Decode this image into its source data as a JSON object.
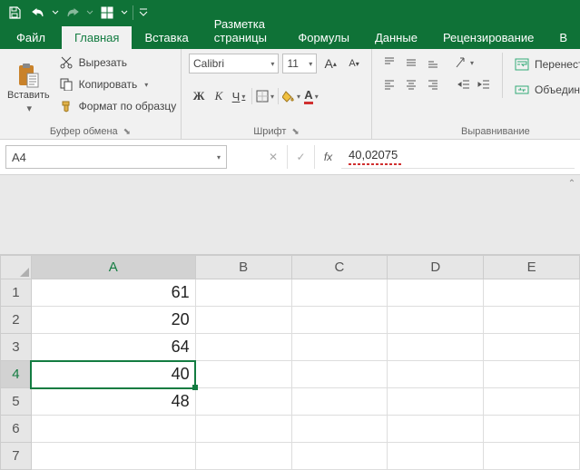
{
  "qat": {
    "save": "save",
    "undo": "undo",
    "redo": "redo",
    "custom": "customize"
  },
  "tabs": {
    "file": "Файл",
    "items": [
      "Главная",
      "Вставка",
      "Разметка страницы",
      "Формулы",
      "Данные",
      "Рецензирование",
      "В"
    ],
    "active_index": 0
  },
  "ribbon": {
    "clipboard": {
      "paste": "Вставить",
      "cut": "Вырезать",
      "copy": "Копировать",
      "painter": "Формат по образцу",
      "label": "Буфер обмена"
    },
    "font": {
      "name": "Calibri",
      "size": "11",
      "bold": "Ж",
      "italic": "К",
      "underline": "Ч",
      "label": "Шрифт"
    },
    "align": {
      "wrap": "Перенести тек",
      "merge": "Объединить и",
      "label": "Выравнивание"
    }
  },
  "formula_bar": {
    "name_box": "A4",
    "value": "40,02075"
  },
  "grid": {
    "cols": [
      "A",
      "B",
      "C",
      "D",
      "E"
    ],
    "selected_col": 0,
    "selected_row": 3,
    "rows": [
      {
        "n": "1",
        "v": "61"
      },
      {
        "n": "2",
        "v": "20"
      },
      {
        "n": "3",
        "v": "64"
      },
      {
        "n": "4",
        "v": "40"
      },
      {
        "n": "5",
        "v": "48"
      },
      {
        "n": "6",
        "v": ""
      },
      {
        "n": "7",
        "v": ""
      }
    ]
  }
}
